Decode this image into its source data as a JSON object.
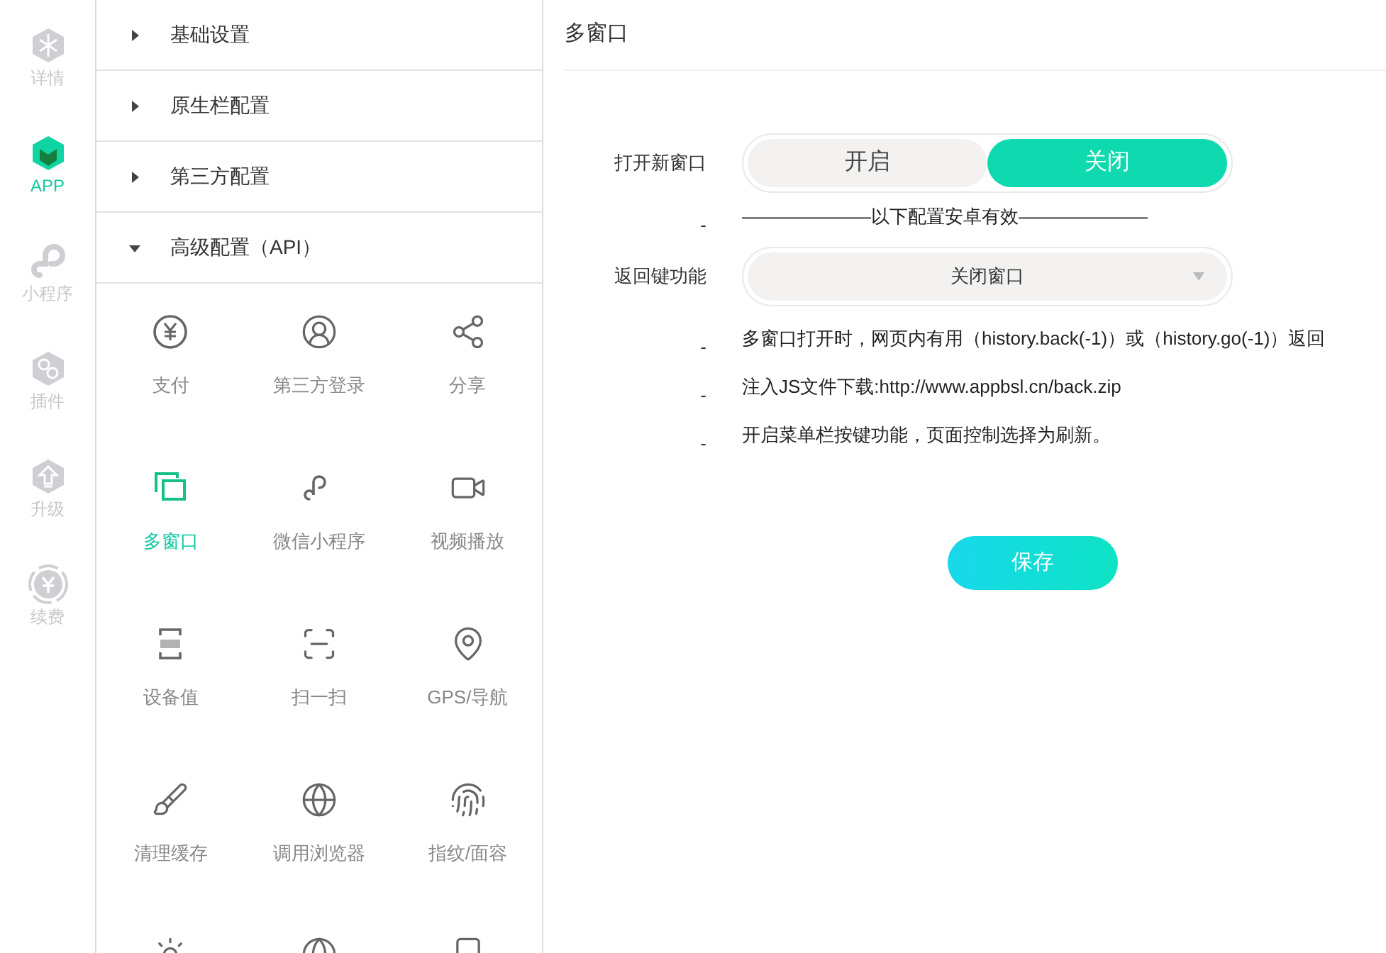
{
  "rail": [
    {
      "label": "详情",
      "selected": false
    },
    {
      "label": "APP",
      "selected": true
    },
    {
      "label": "小程序",
      "selected": false
    },
    {
      "label": "插件",
      "selected": false
    },
    {
      "label": "升级",
      "selected": false
    },
    {
      "label": "续费",
      "selected": false
    }
  ],
  "sections": [
    {
      "label": "基础设置",
      "expanded": false
    },
    {
      "label": "原生栏配置",
      "expanded": false
    },
    {
      "label": "第三方配置",
      "expanded": false
    },
    {
      "label": "高级配置（API）",
      "expanded": true
    }
  ],
  "features": [
    {
      "label": "支付",
      "selected": false
    },
    {
      "label": "第三方登录",
      "selected": false
    },
    {
      "label": "分享",
      "selected": false
    },
    {
      "label": "多窗口",
      "selected": true
    },
    {
      "label": "微信小程序",
      "selected": false
    },
    {
      "label": "视频播放",
      "selected": false
    },
    {
      "label": "设备值",
      "selected": false
    },
    {
      "label": "扫一扫",
      "selected": false
    },
    {
      "label": "GPS/导航",
      "selected": false
    },
    {
      "label": "清理缓存",
      "selected": false
    },
    {
      "label": "调用浏览器",
      "selected": false
    },
    {
      "label": "指纹/面容",
      "selected": false
    }
  ],
  "page_title": "多窗口",
  "open_window": {
    "label": "打开新窗口",
    "options": [
      {
        "label": "开启",
        "selected": false
      },
      {
        "label": "关闭",
        "selected": true
      }
    ]
  },
  "divider_note": {
    "marker": "-",
    "text": "———————以下配置安卓有效———————"
  },
  "back_key": {
    "label": "返回键功能",
    "value": "关闭窗口"
  },
  "notes": [
    {
      "marker": "-",
      "text": "多窗口打开时，网页内有用（history.back(-1)）或（history.go(-1)）返回"
    },
    {
      "marker": "-",
      "text": "注入JS文件下载:http://www.appbsl.cn/back.zip"
    },
    {
      "marker": "-",
      "text": "开启菜单栏按键功能，页面控制选择为刷新。"
    }
  ],
  "save_button": "保存"
}
